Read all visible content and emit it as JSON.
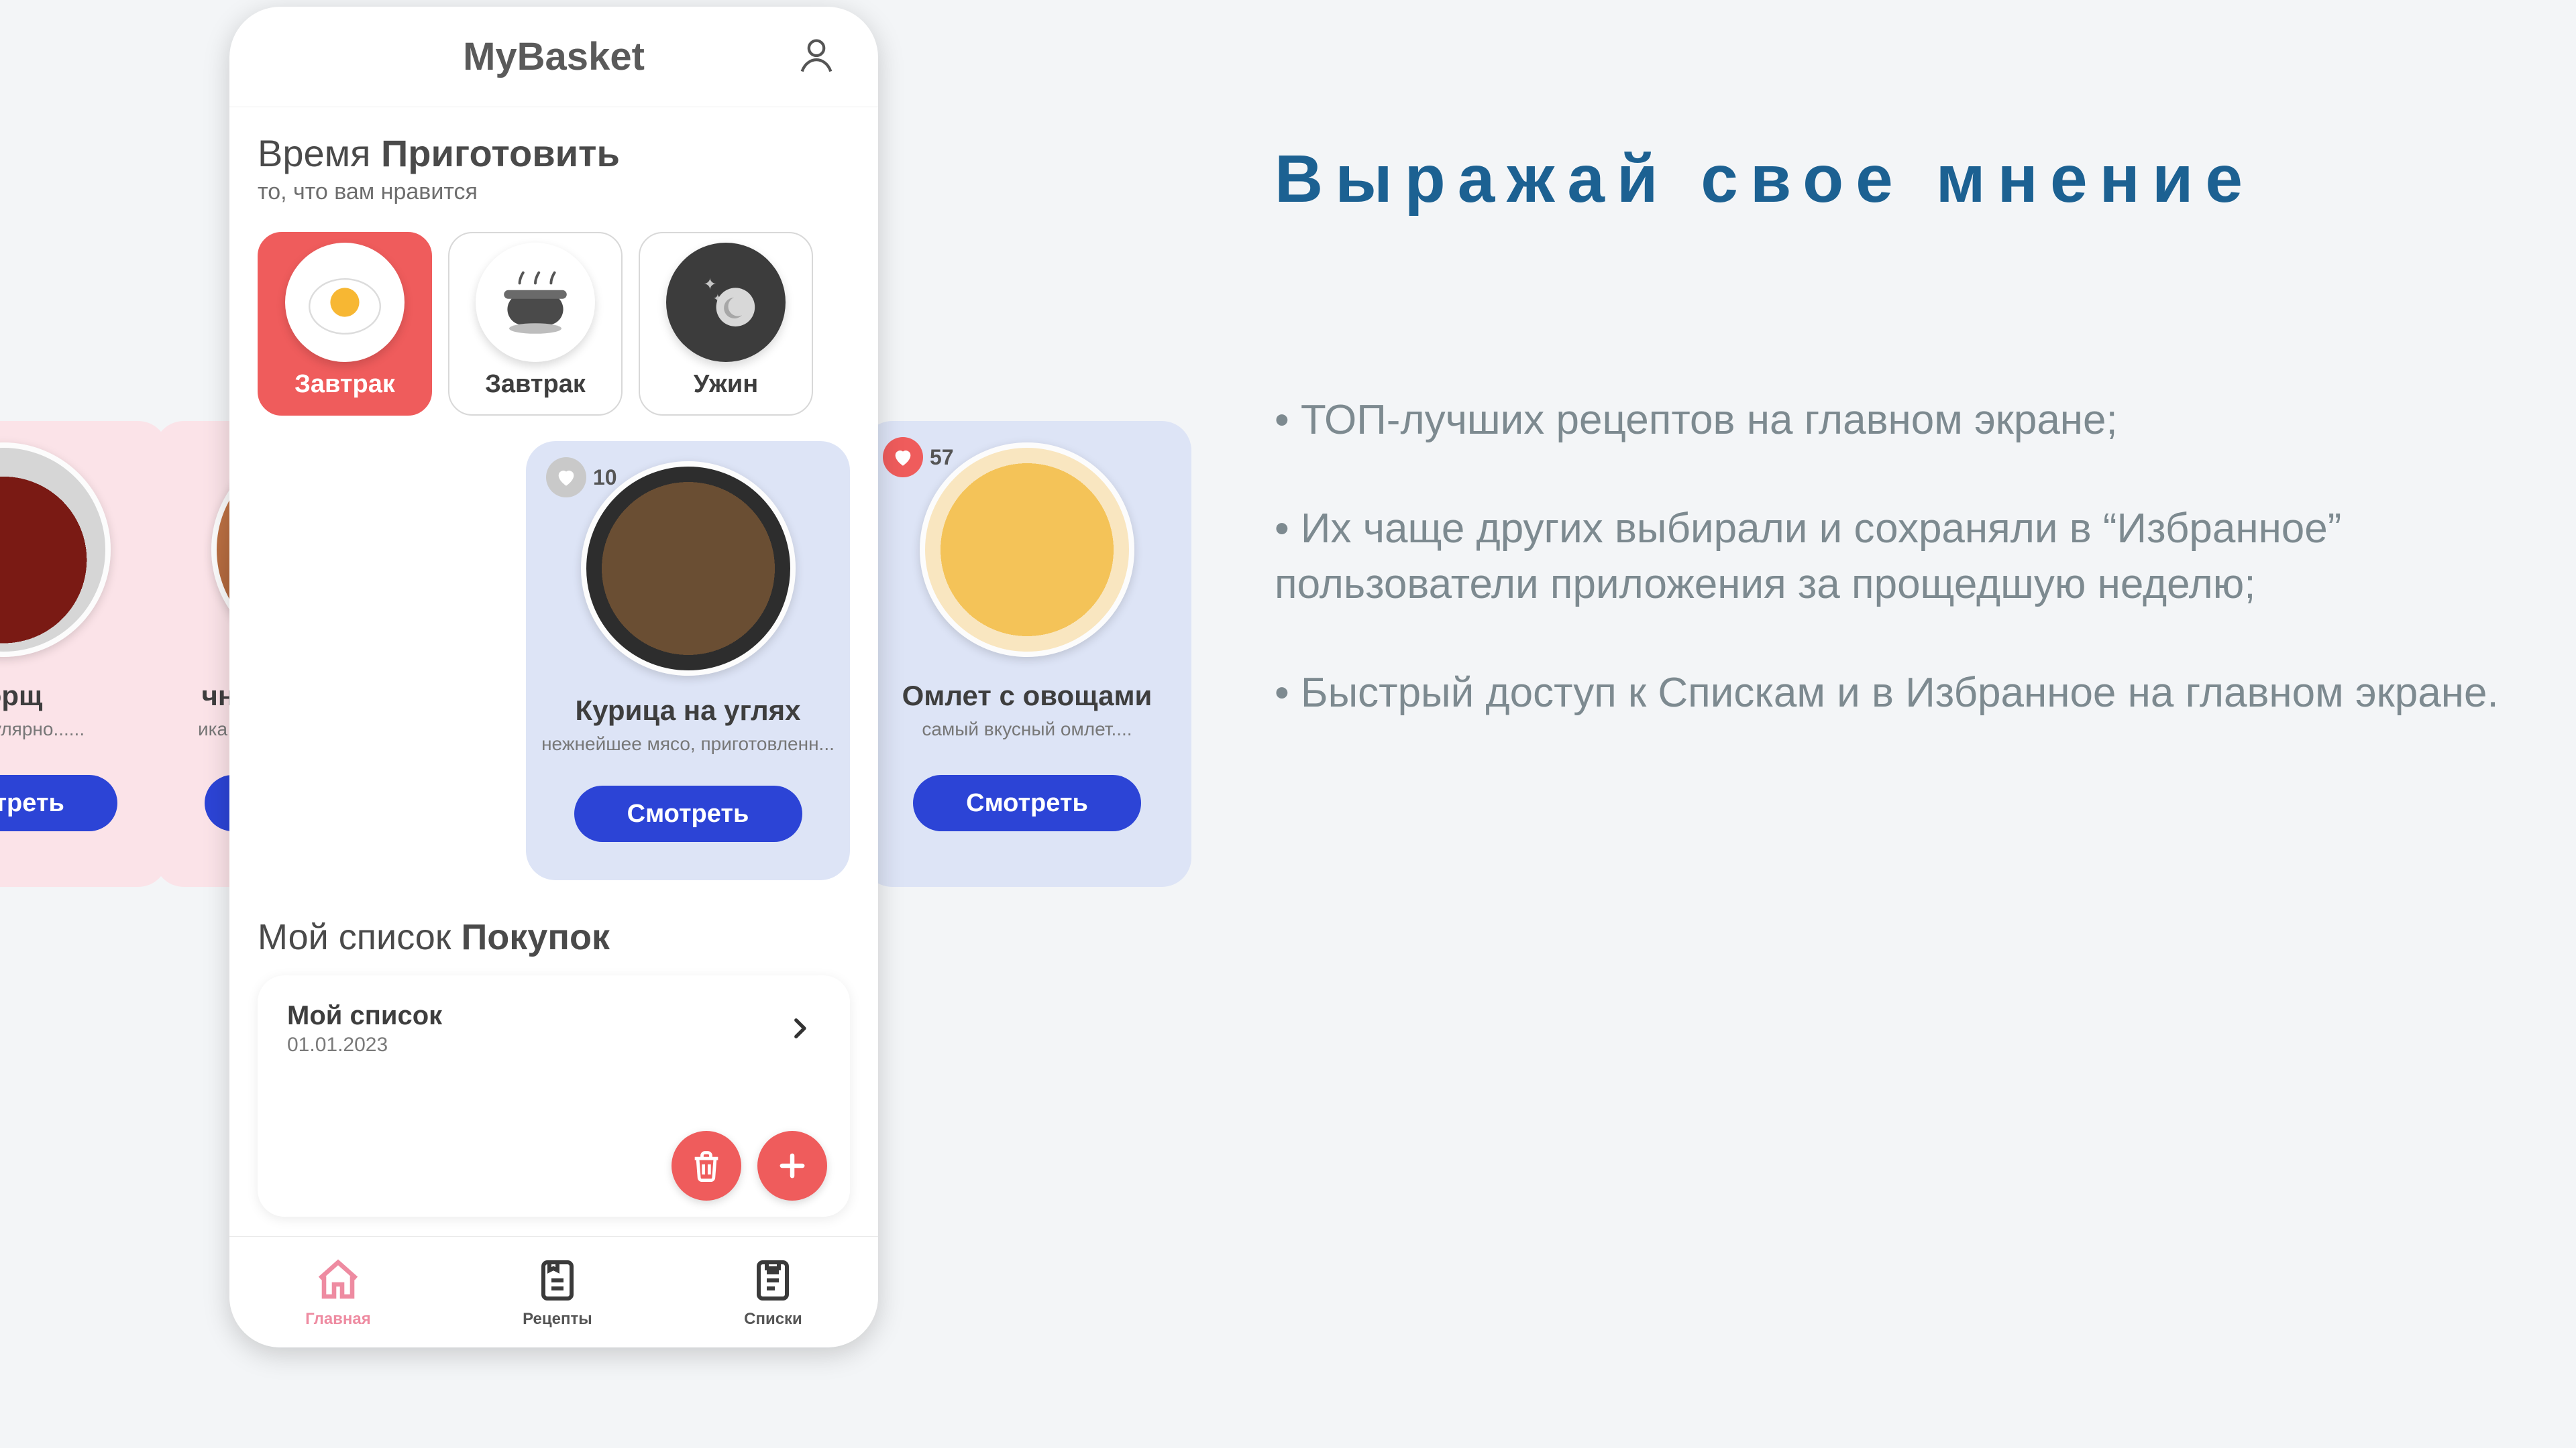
{
  "colors": {
    "accent": "#ef5c5c",
    "primaryBlue": "#2c44d6",
    "titleBlue": "#1c6192",
    "navActive": "#ee8ba1"
  },
  "app": {
    "title": "MyBasket"
  },
  "timeCook": {
    "light": "Время",
    "bold": "Приготовить",
    "sub": "то, что вам нравится"
  },
  "meals": [
    {
      "label": "Завтрак",
      "active": true
    },
    {
      "label": "Завтрак",
      "active": false
    },
    {
      "label": "Ужин",
      "active": false
    }
  ],
  "recipes": {
    "watch": "Смотреть",
    "overflowLeftFar": {
      "title": "Борщ",
      "desc": "мое популярно......",
      "bg": "pink"
    },
    "overflowLeftNear": {
      "title": "чница с беконом",
      "desc": "ика проверенная временем",
      "bg": "pink"
    },
    "insideA": {
      "title": "Курица на углях",
      "desc": "нежнейшее мясо, приготовленн...",
      "likes": "10",
      "liked": false,
      "bg": "blue"
    },
    "overflowRight": {
      "title": "Омлет с овощами",
      "desc": "самый вкусный омлет....",
      "likes": "57",
      "liked": true,
      "bg": "blue"
    }
  },
  "shopping": {
    "light": "Мой список",
    "bold": "Покупок",
    "list": {
      "title": "Мой список",
      "date": "01.01.2023"
    }
  },
  "nav": [
    {
      "label": "Главная",
      "active": true
    },
    {
      "label": "Рецепты",
      "active": false
    },
    {
      "label": "Списки",
      "active": false
    }
  ],
  "marketing": {
    "title": "Выражай  свое  мнение",
    "b1": "•  ТОП-лучших рецептов на главном экране;",
    "b2": "•   Их чаще других выбирали и сохраняли в “Избранное” пользователи приложения за прощедшую неделю;",
    "b3": "•   Быстрый доступ к Спискам и в Избранное на главном экране."
  }
}
